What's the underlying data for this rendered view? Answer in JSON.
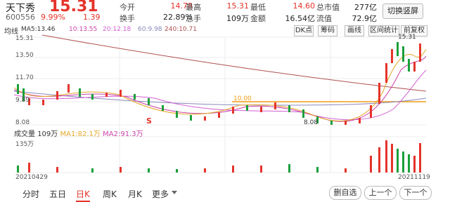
{
  "stock": {
    "name": "天下秀",
    "code": "600556",
    "price": "15.31",
    "change_pct": "9.99%",
    "change_amt": "1.39"
  },
  "stats": {
    "open_label": "今开",
    "open": "14.78",
    "high_label": "最高",
    "high": "15.31",
    "low_label": "最低",
    "low": "14.60",
    "mcap_label": "总市值",
    "mcap": "277亿",
    "turnover_label": "换手",
    "turnover": "22.89%",
    "hands_label": "总手",
    "hands": "109万",
    "amount_label": "金额",
    "amount": "16.54亿",
    "float_label": "流值",
    "float": "72.9亿"
  },
  "header": {
    "switch_button": "切换竖屏"
  },
  "toolbar": {
    "ma_title": "均线",
    "ma5": "MA5:13.46",
    "ma10": "10:13.55",
    "ma20": "20:12.18",
    "ma60": "60:9.98",
    "ma240": "240:10.71",
    "btn_dk": "DK点",
    "btn_chip": "筹码",
    "btn_draw": "画线",
    "btn_range": "区间统计",
    "btn_adjust": "前复权"
  },
  "price_axis": {
    "p1": "15.31",
    "p2": "13.50",
    "p3": "11.70",
    "p4": "9.89",
    "p5": "8.08"
  },
  "annotations": {
    "high_marker": "15.31",
    "low_marker": "8.08",
    "level_line": "10.00",
    "s_markers": [
      "S"
    ]
  },
  "volume": {
    "title": "成交量",
    "value": "109万",
    "ma1": "MA1:82.1万",
    "ma2": "MA2:91.3万",
    "axis_max": "135万"
  },
  "dates": {
    "start": "20210429",
    "end": "20211119"
  },
  "tabs": [
    "分时",
    "五日",
    "日K",
    "周K",
    "月K",
    "更多"
  ],
  "active_tab": "日K",
  "actions": {
    "delete_fav": "删自选",
    "prev": "上一个",
    "next": "下一个"
  },
  "colors": {
    "up": "#e5332a",
    "down": "#1a9f3a",
    "ma5": "#e2a82a",
    "ma10": "#cc44aa",
    "ma20": "#d060d0",
    "ma60": "#8888bb",
    "ma240": "#b05050",
    "level": "#f39c12"
  }
}
